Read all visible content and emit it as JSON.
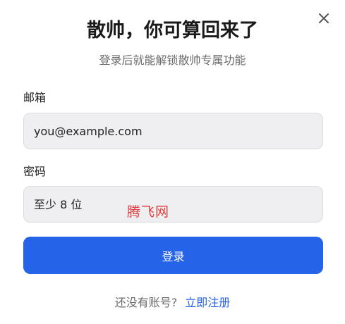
{
  "dialog": {
    "title": "散帅，你可算回来了",
    "subtitle": "登录后就能解锁散帅专属功能",
    "close_icon": "close-icon"
  },
  "form": {
    "email_label": "邮箱",
    "email_placeholder": "you@example.com",
    "password_label": "密码",
    "password_placeholder": "至少 8 位",
    "submit_label": "登录"
  },
  "footer": {
    "prompt": "还没有账号?",
    "register_link": "立即注册"
  },
  "watermark": {
    "text": "腾飞网"
  },
  "colors": {
    "accent": "#2563e8",
    "input_bg": "#efeff2",
    "watermark": "#e03c3c"
  }
}
